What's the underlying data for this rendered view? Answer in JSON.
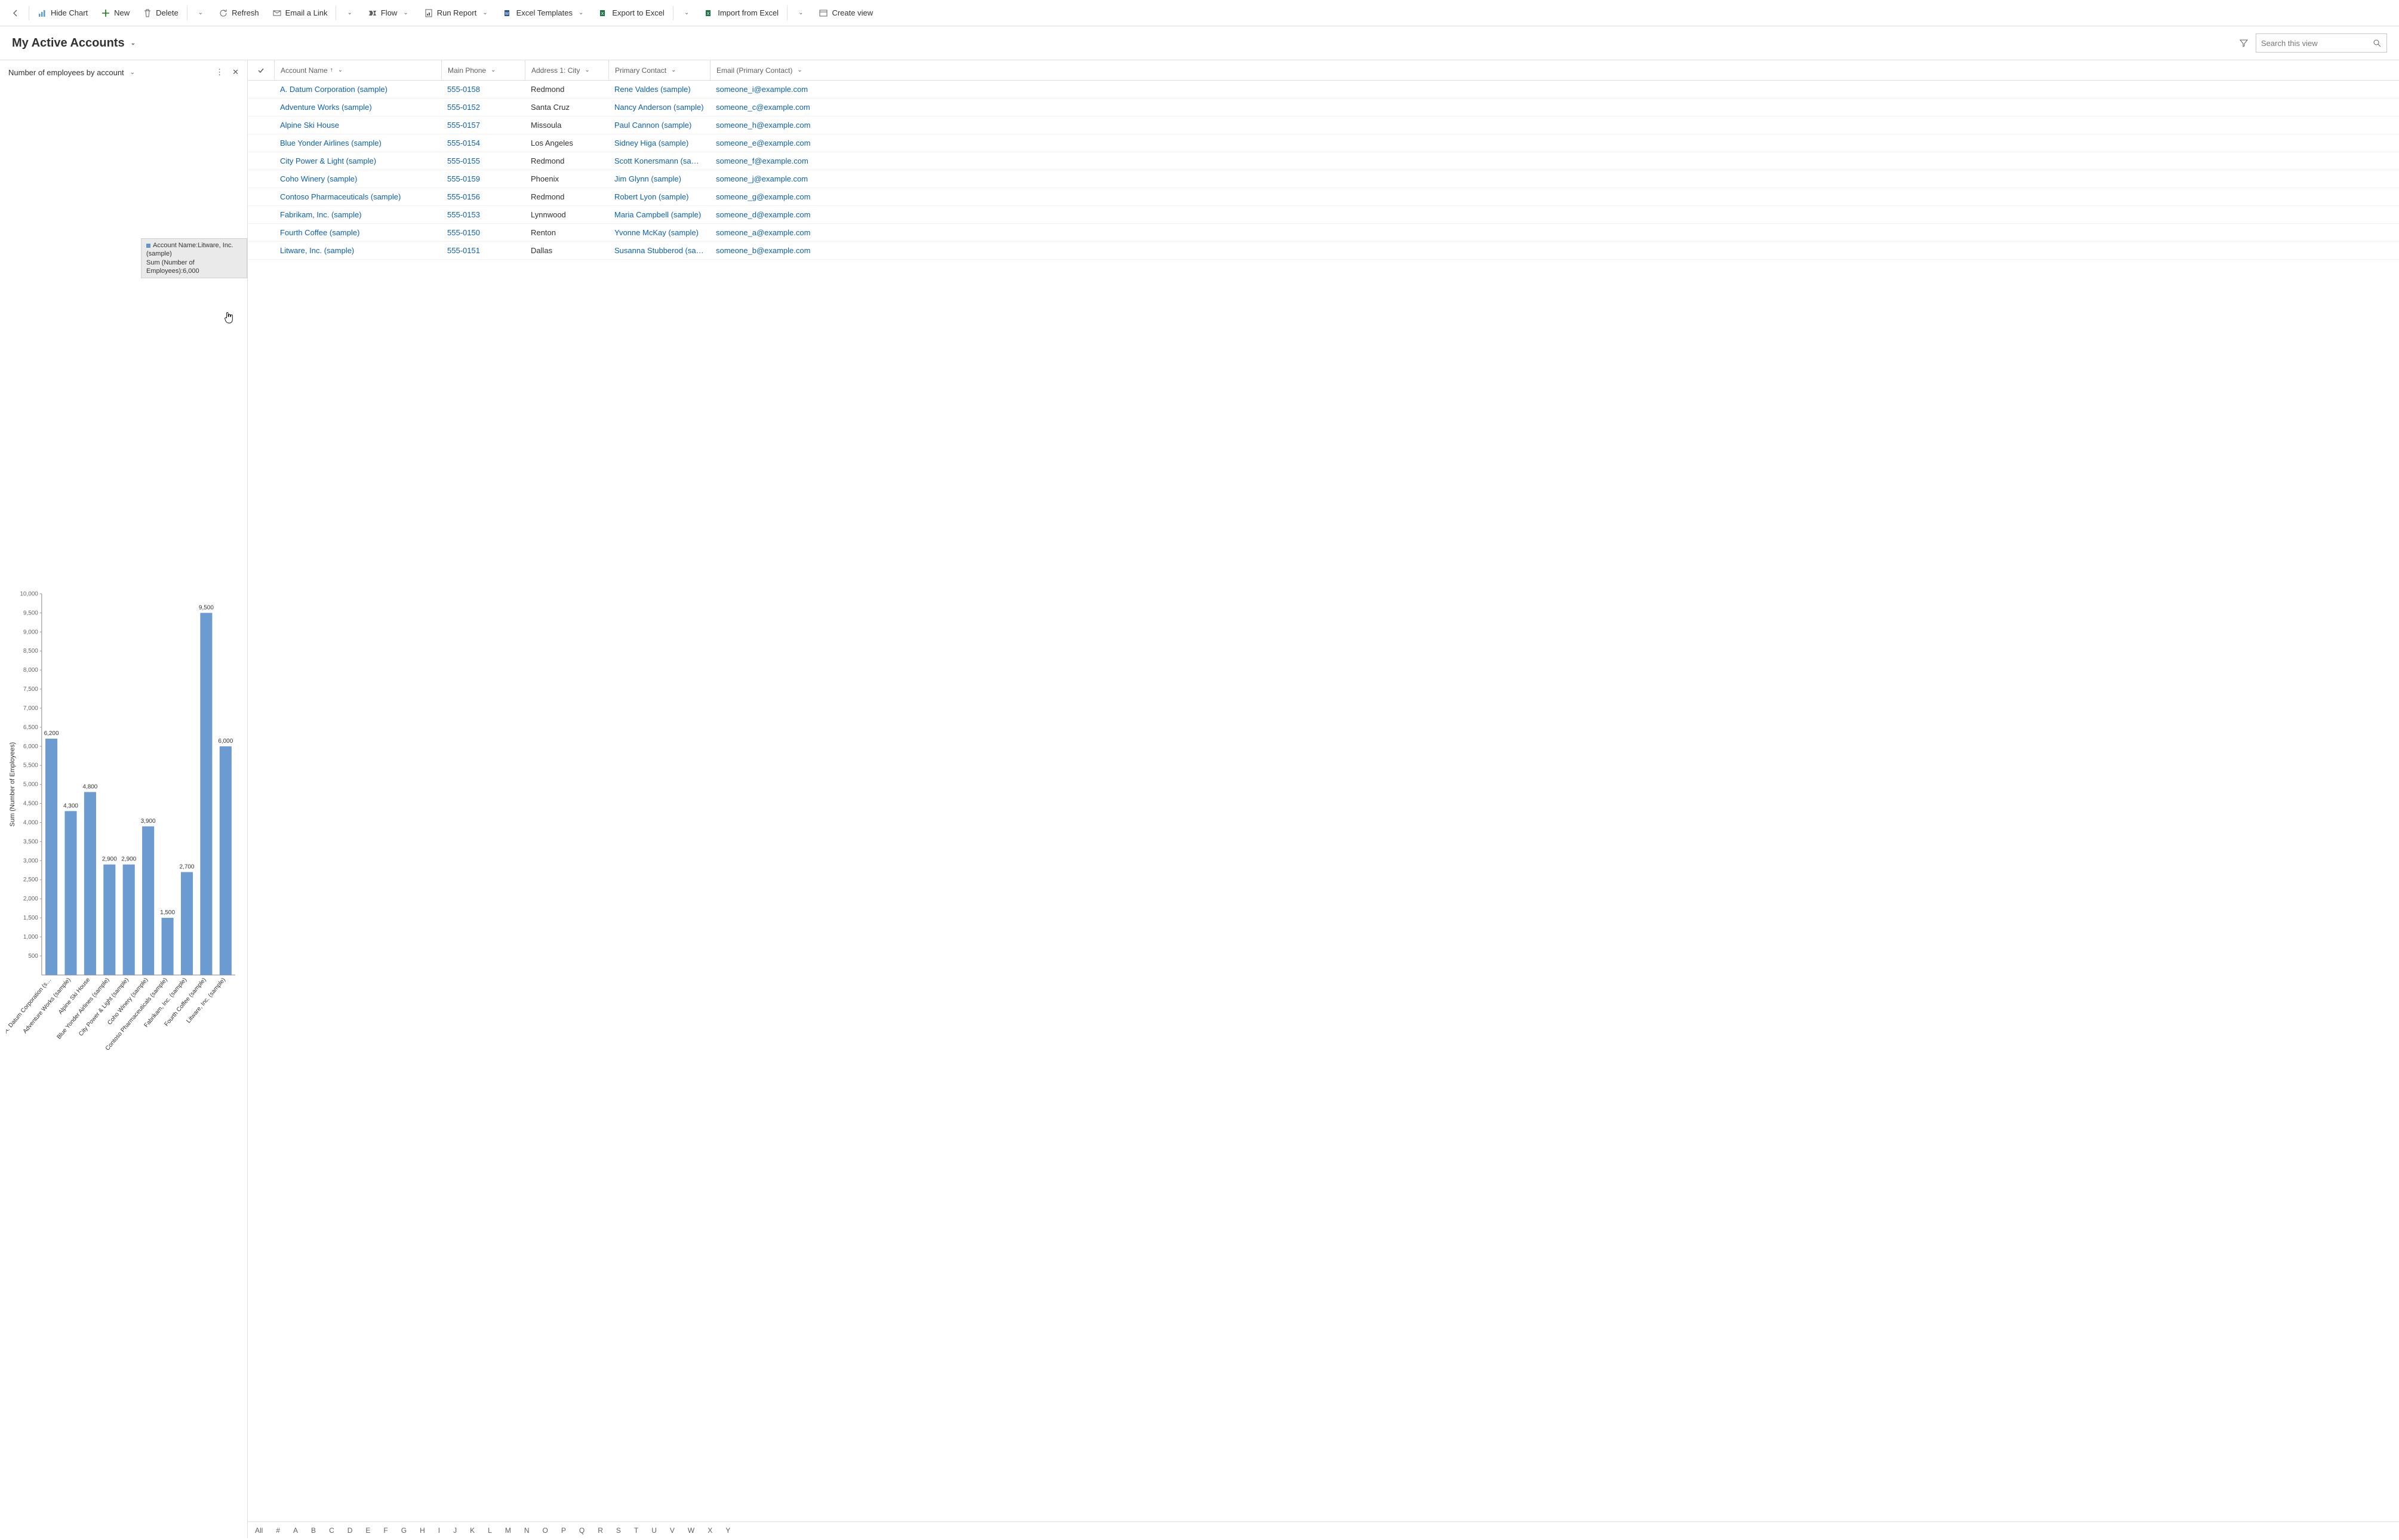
{
  "commands": {
    "back_icon": "back",
    "hide_chart": "Hide Chart",
    "new": "New",
    "delete": "Delete",
    "refresh": "Refresh",
    "email_link": "Email a Link",
    "flow": "Flow",
    "run_report": "Run Report",
    "excel_templates": "Excel Templates",
    "export_excel": "Export to Excel",
    "import_excel": "Import from Excel",
    "create_view": "Create view"
  },
  "header": {
    "view_title": "My Active Accounts",
    "search_placeholder": "Search this view"
  },
  "chart_pane": {
    "title": "Number of employees by account"
  },
  "tooltip": {
    "line1": "Account Name:Litware, Inc. (sample)",
    "line2": "Sum (Number of Employees):6,000"
  },
  "chart_data": {
    "type": "bar",
    "title": "Number of employees by account",
    "ylabel": "Sum (Number of Employees)",
    "xlabel": "",
    "ylim": [
      0,
      10000
    ],
    "yticks": [
      500,
      1000,
      1500,
      2000,
      2500,
      3000,
      3500,
      4000,
      4500,
      5000,
      5500,
      6000,
      6500,
      7000,
      7500,
      8000,
      8500,
      9000,
      9500,
      10000
    ],
    "categories": [
      "A. Datum Corporation (s…",
      "Adventure Works (sample)",
      "Alpine Ski House",
      "Blue Yonder Airlines (sample)",
      "City Power & Light (sample)",
      "Coho Winery (sample)",
      "Contoso Pharmaceuticals (sample)",
      "Fabrikam, Inc. (sample)",
      "Fourth Coffee (sample)",
      "Litware, Inc. (sample)"
    ],
    "values": [
      6200,
      4300,
      4800,
      2900,
      2900,
      3900,
      1500,
      2700,
      9500,
      6000
    ],
    "value_labels": [
      "6,200",
      "4,300",
      "4,800",
      "2,900",
      "2,900",
      "3,900",
      "1,500",
      "2,700",
      "9,500",
      "6,000"
    ]
  },
  "grid": {
    "columns": {
      "account": "Account Name",
      "phone": "Main Phone",
      "city": "Address 1: City",
      "contact": "Primary Contact",
      "email": "Email (Primary Contact)"
    },
    "rows": [
      {
        "acct": "A. Datum Corporation (sample)",
        "phone": "555-0158",
        "city": "Redmond",
        "contact": "Rene Valdes (sample)",
        "email": "someone_i@example.com"
      },
      {
        "acct": "Adventure Works (sample)",
        "phone": "555-0152",
        "city": "Santa Cruz",
        "contact": "Nancy Anderson (sample)",
        "email": "someone_c@example.com"
      },
      {
        "acct": "Alpine Ski House",
        "phone": "555-0157",
        "city": "Missoula",
        "contact": "Paul Cannon (sample)",
        "email": "someone_h@example.com"
      },
      {
        "acct": "Blue Yonder Airlines (sample)",
        "phone": "555-0154",
        "city": "Los Angeles",
        "contact": "Sidney Higa (sample)",
        "email": "someone_e@example.com"
      },
      {
        "acct": "City Power & Light (sample)",
        "phone": "555-0155",
        "city": "Redmond",
        "contact": "Scott Konersmann (sample)",
        "email": "someone_f@example.com"
      },
      {
        "acct": "Coho Winery (sample)",
        "phone": "555-0159",
        "city": "Phoenix",
        "contact": "Jim Glynn (sample)",
        "email": "someone_j@example.com"
      },
      {
        "acct": "Contoso Pharmaceuticals (sample)",
        "phone": "555-0156",
        "city": "Redmond",
        "contact": "Robert Lyon (sample)",
        "email": "someone_g@example.com"
      },
      {
        "acct": "Fabrikam, Inc. (sample)",
        "phone": "555-0153",
        "city": "Lynnwood",
        "contact": "Maria Campbell (sample)",
        "email": "someone_d@example.com"
      },
      {
        "acct": "Fourth Coffee (sample)",
        "phone": "555-0150",
        "city": "Renton",
        "contact": "Yvonne McKay (sample)",
        "email": "someone_a@example.com"
      },
      {
        "acct": "Litware, Inc. (sample)",
        "phone": "555-0151",
        "city": "Dallas",
        "contact": "Susanna Stubberod (sample)",
        "email": "someone_b@example.com"
      }
    ]
  },
  "alpha": [
    "All",
    "#",
    "A",
    "B",
    "C",
    "D",
    "E",
    "F",
    "G",
    "H",
    "I",
    "J",
    "K",
    "L",
    "M",
    "N",
    "O",
    "P",
    "Q",
    "R",
    "S",
    "T",
    "U",
    "V",
    "W",
    "X",
    "Y"
  ]
}
